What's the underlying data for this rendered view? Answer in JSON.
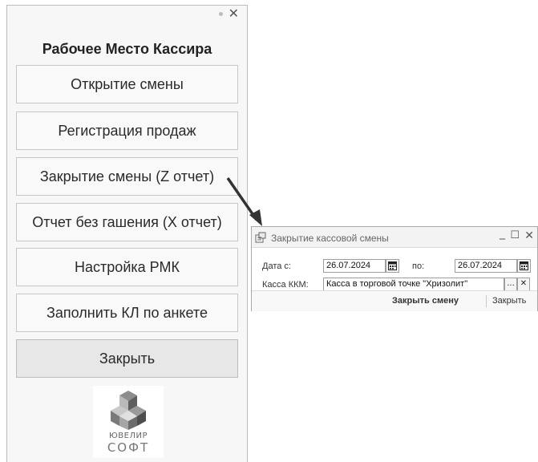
{
  "panel": {
    "title": "Рабочее Место Кассира",
    "buttons": [
      {
        "label": "Открытие смены"
      },
      {
        "label": "Регистрация продаж"
      },
      {
        "label": "Закрытие смены (Z отчет)"
      },
      {
        "label": "Отчет без гашения (X отчет)"
      },
      {
        "label": "Настройка РМК"
      },
      {
        "label": "Заполнить КЛ по анкете"
      },
      {
        "label": "Закрыть",
        "selected": true
      }
    ],
    "logo": {
      "line1": "ЮВЕЛИР",
      "line2": "СОФТ"
    }
  },
  "dialog": {
    "title": "Закрытие кассовой смены",
    "date_from_label": "Дата с:",
    "date_from_value": "26.07.2024",
    "date_to_label": "по:",
    "date_to_value": "26.07.2024",
    "kkm_label": "Касса ККМ:",
    "kkm_value": "Касса в торговой точке \"Хризолит\"",
    "select_button_label": "...",
    "clear_button_label": "✕",
    "close_shift_button": "Закрыть смену",
    "close_button": "Закрыть"
  },
  "icons": [
    "pin-icon",
    "close-icon",
    "calendar-icon",
    "minimize-icon",
    "maximize-icon",
    "dialog-form-icon",
    "logo-icon",
    "arrow-icon"
  ],
  "colors": {
    "panel_bg": "#f7f7f7",
    "button_bg": "#f9f9f9",
    "button_selected_bg": "#e7e7e7",
    "dialog_title": "#666666"
  }
}
